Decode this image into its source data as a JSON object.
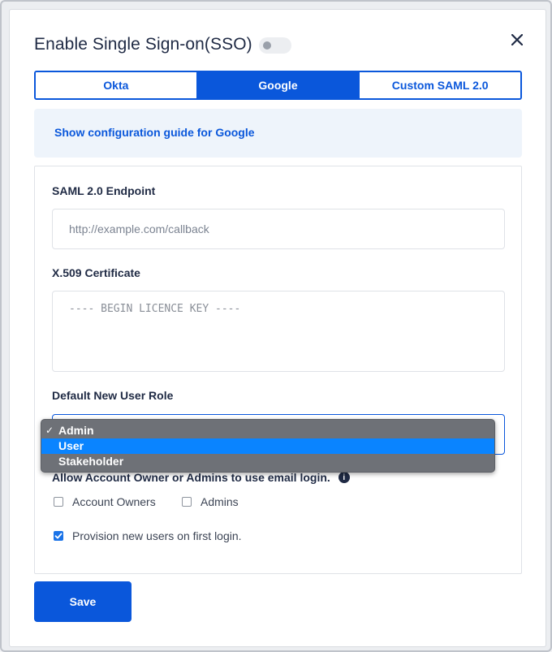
{
  "modal": {
    "title": "Enable Single Sign-on(SSO)",
    "close_label": "✕"
  },
  "tabs": [
    {
      "label": "Okta",
      "active": false
    },
    {
      "label": "Google",
      "active": true
    },
    {
      "label": "Custom SAML 2.0",
      "active": false
    }
  ],
  "guide": {
    "link_text": "Show configuration guide for Google"
  },
  "form": {
    "endpoint_label": "SAML 2.0 Endpoint",
    "endpoint_placeholder": "http://example.com/callback",
    "certificate_label": "X.509 Certificate",
    "certificate_placeholder": "---- BEGIN LICENCE KEY ----",
    "role_label": "Default New User Role",
    "email_login_label": "Allow Account Owner or Admins to use email login.",
    "info_icon_text": "i",
    "checkbox_account_owners": "Account Owners",
    "checkbox_admins": "Admins",
    "checkbox_provision": "Provision new users on first login."
  },
  "dropdown": {
    "options": [
      "Admin",
      "User",
      "Stakeholder"
    ],
    "selected": "Admin",
    "highlighted": "User",
    "check_mark": "✓"
  },
  "actions": {
    "save_label": "Save"
  },
  "colors": {
    "accent": "#0a57db",
    "highlight": "#0a84ff",
    "guide_bg": "#eef4fb"
  }
}
